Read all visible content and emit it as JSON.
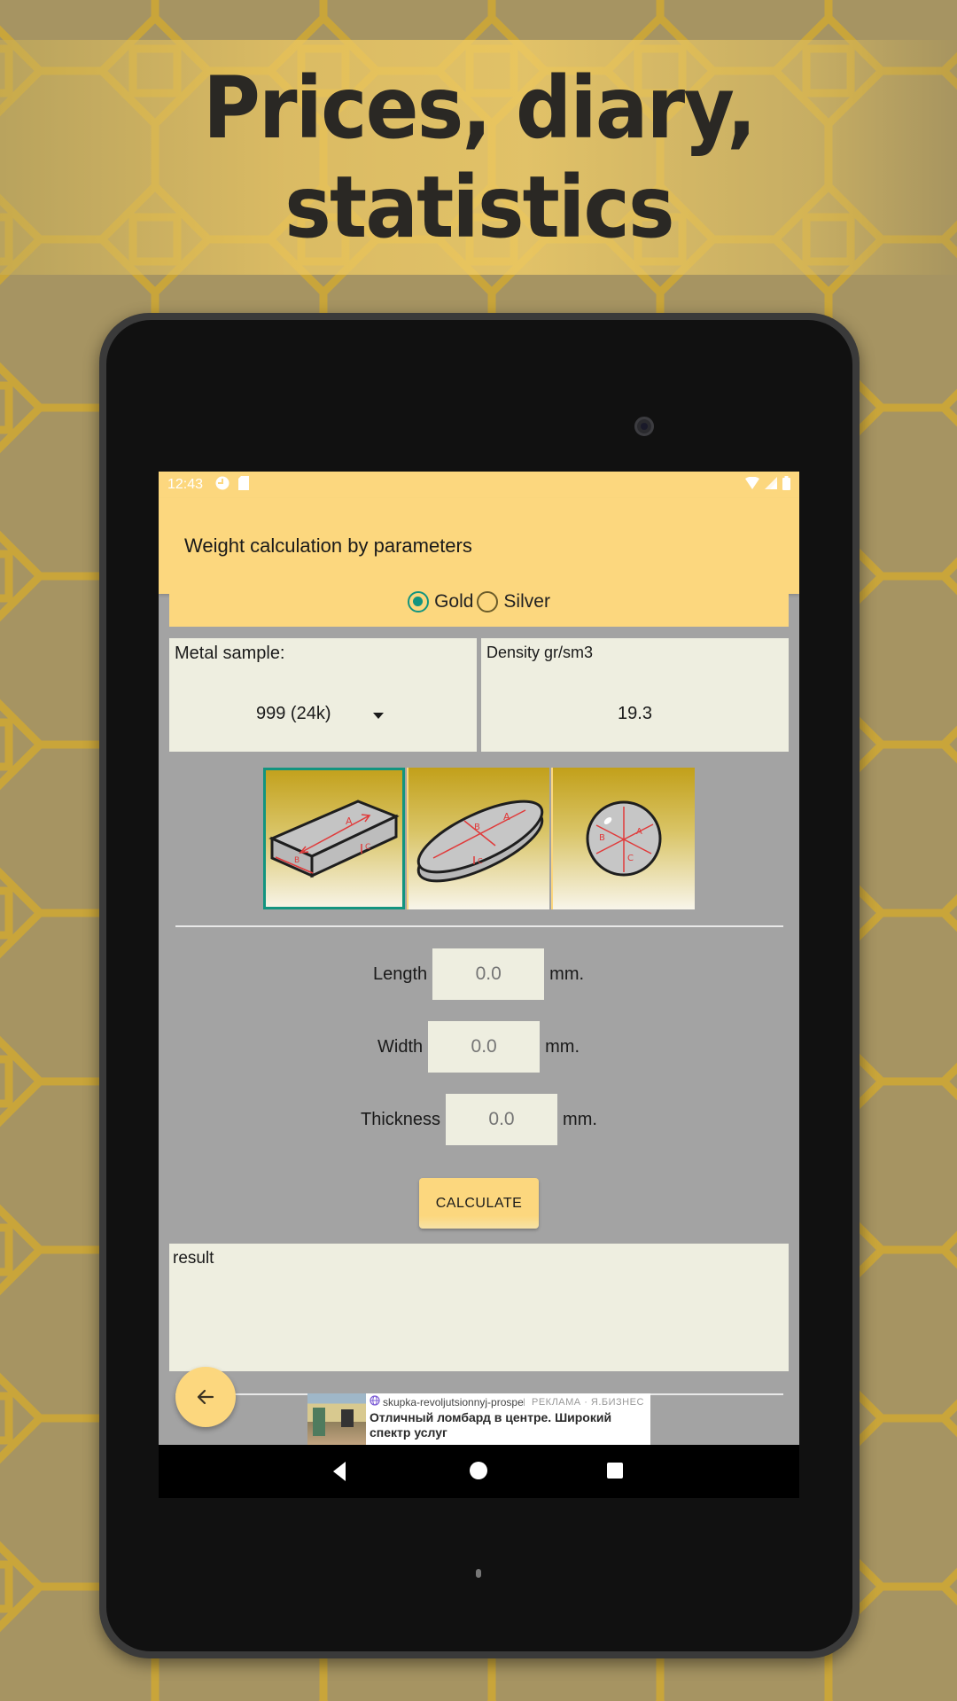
{
  "banner": {
    "title_line1": "Prices, diary,",
    "title_line2": "statistics"
  },
  "status_bar": {
    "time": "12:43",
    "left_icons": [
      "notification-app-icon",
      "sd-card-icon"
    ],
    "right_icons": [
      "wifi-icon",
      "cell-signal-icon",
      "battery-icon"
    ]
  },
  "app_bar": {
    "title": "Weight calculation by parameters"
  },
  "metal_selector": {
    "options": [
      {
        "label": "Gold",
        "checked": true
      },
      {
        "label": "Silver",
        "checked": false
      }
    ]
  },
  "metal_sample": {
    "label": "Metal sample:",
    "selected": "999 (24k)"
  },
  "density": {
    "label": "Density gr/sm3",
    "value": "19.3"
  },
  "shapes": [
    {
      "name": "bar",
      "icon": "rectangular-bar-icon",
      "selected": true,
      "dimension_labels": [
        "A",
        "B",
        "C"
      ]
    },
    {
      "name": "oval",
      "icon": "oval-disc-icon",
      "selected": false,
      "dimension_labels": [
        "A",
        "B",
        "C"
      ]
    },
    {
      "name": "sphere",
      "icon": "sphere-icon",
      "selected": false,
      "dimension_labels": [
        "A",
        "B",
        "C"
      ]
    }
  ],
  "parameters": [
    {
      "label": "Length",
      "placeholder": "0.0",
      "value": "",
      "unit": "mm."
    },
    {
      "label": "Width",
      "placeholder": "0.0",
      "value": "",
      "unit": "mm."
    },
    {
      "label": "Thickness",
      "placeholder": "0.0",
      "value": "",
      "unit": "mm."
    }
  ],
  "calculate_button": {
    "label": "CALCULATE"
  },
  "result": {
    "text": "result"
  },
  "fab": {
    "icon": "arrow-left-icon"
  },
  "ad": {
    "domain": "skupka-revoljutsionnyj-prospek",
    "label": "РЕКЛАМА · Я.БИЗНЕС",
    "headline": "Отличный ломбард в центре. Широкий спектр услуг"
  },
  "nav_bar": {
    "buttons": [
      "back",
      "home",
      "recents"
    ]
  },
  "colors": {
    "accent_yellow": "#fcd77e",
    "radio_checked": "#13947f",
    "screen_bg": "#a3a3a3",
    "panel_bg": "#eeeee0"
  }
}
